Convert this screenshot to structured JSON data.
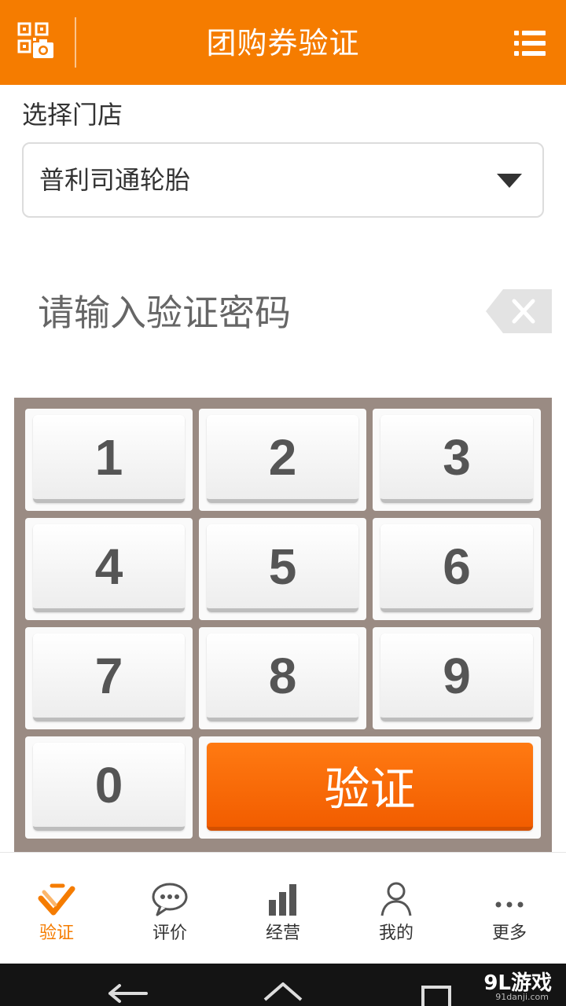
{
  "header": {
    "title": "团购券验证",
    "scan_icon": "qr-scan-icon",
    "menu_icon": "menu-list-icon"
  },
  "store": {
    "label": "选择门店",
    "selected": "普利司通轮胎"
  },
  "password": {
    "placeholder": "请输入验证密码",
    "value": ""
  },
  "keypad": {
    "keys": [
      "1",
      "2",
      "3",
      "4",
      "5",
      "6",
      "7",
      "8",
      "9",
      "0"
    ],
    "verify_label": "验证"
  },
  "nav": {
    "items": [
      {
        "label": "验证",
        "icon": "check-verify-icon",
        "active": true
      },
      {
        "label": "评价",
        "icon": "chat-bubble-icon",
        "active": false
      },
      {
        "label": "经营",
        "icon": "bar-chart-icon",
        "active": false
      },
      {
        "label": "我的",
        "icon": "person-icon",
        "active": false
      },
      {
        "label": "更多",
        "icon": "more-dots-icon",
        "active": false
      }
    ]
  },
  "system": {
    "watermark": "9L游戏",
    "watermark_sub": "91danji.com"
  },
  "colors": {
    "accent": "#f57c00",
    "keypad_bg": "#9a8b83",
    "verify_button": "#f25d00",
    "system_bar": "#141414"
  }
}
